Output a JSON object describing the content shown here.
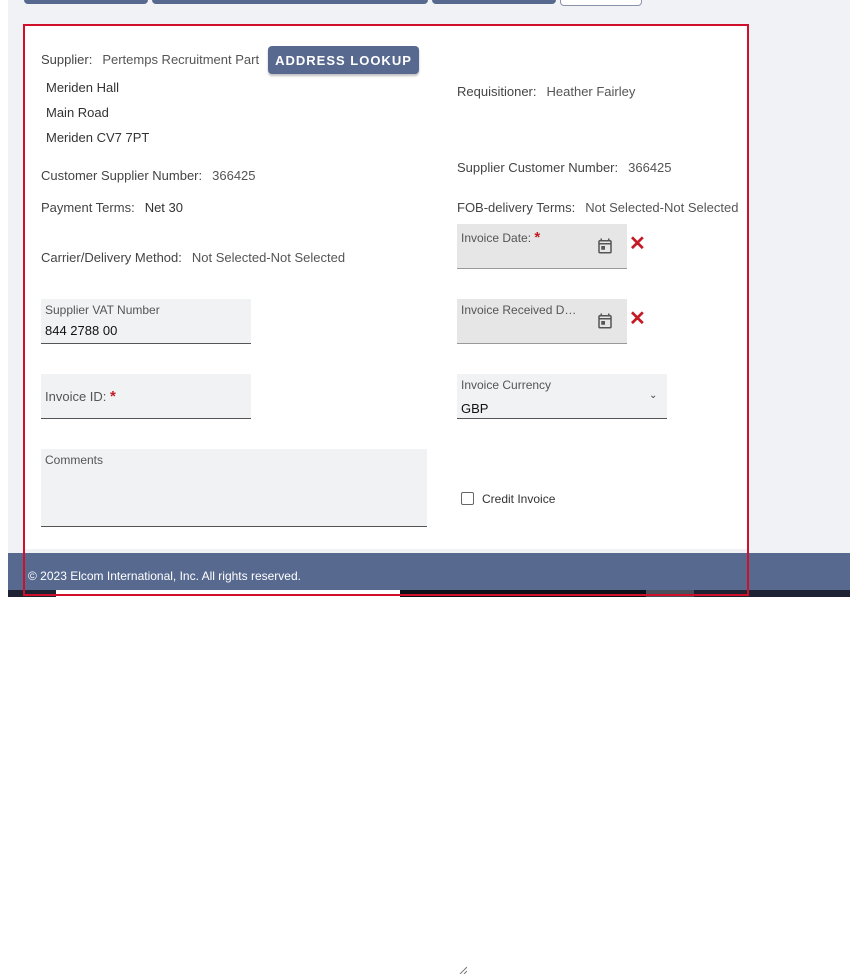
{
  "colors": {
    "accent": "#58698f",
    "required": "#c31a25",
    "frame": "#d0102b"
  },
  "supplier": {
    "label": "Supplier:",
    "name": "Pertemps Recruitment Part",
    "address_lookup_label": "ADDRESS LOOKUP",
    "address": [
      "Meriden Hall",
      "Main Road",
      "Meriden CV7 7PT"
    ]
  },
  "requisitioner": {
    "label": "Requisitioner:",
    "value": "Heather Fairley"
  },
  "customer_supplier_number": {
    "label": "Customer Supplier Number:",
    "value": "366425"
  },
  "supplier_customer_number": {
    "label": "Supplier Customer Number:",
    "value": "366425"
  },
  "payment_terms": {
    "label": "Payment Terms:",
    "value": "Net 30"
  },
  "fob_terms": {
    "label": "FOB-delivery Terms:",
    "value": "Not Selected-Not Selected"
  },
  "carrier": {
    "label": "Carrier/Delivery Method:",
    "value": "Not Selected-Not Selected"
  },
  "invoice_date": {
    "label": "Invoice Date:",
    "required_mark": "*",
    "icon": "calendar-icon",
    "clear_icon": "close-icon"
  },
  "supplier_vat": {
    "label": "Supplier VAT Number",
    "value": "844 2788 00"
  },
  "invoice_received_date": {
    "label": "Invoice Received Dat...",
    "icon": "calendar-icon",
    "clear_icon": "close-icon"
  },
  "invoice_id": {
    "label": "Invoice ID:",
    "required_mark": "*"
  },
  "invoice_currency": {
    "label": "Invoice Currency",
    "value": "GBP",
    "icon": "chevron-down-icon"
  },
  "comments": {
    "label": "Comments"
  },
  "credit_invoice": {
    "label": "Credit Invoice",
    "checked": false
  },
  "footer": {
    "text": "© 2023  Elcom International, Inc. All rights reserved."
  }
}
